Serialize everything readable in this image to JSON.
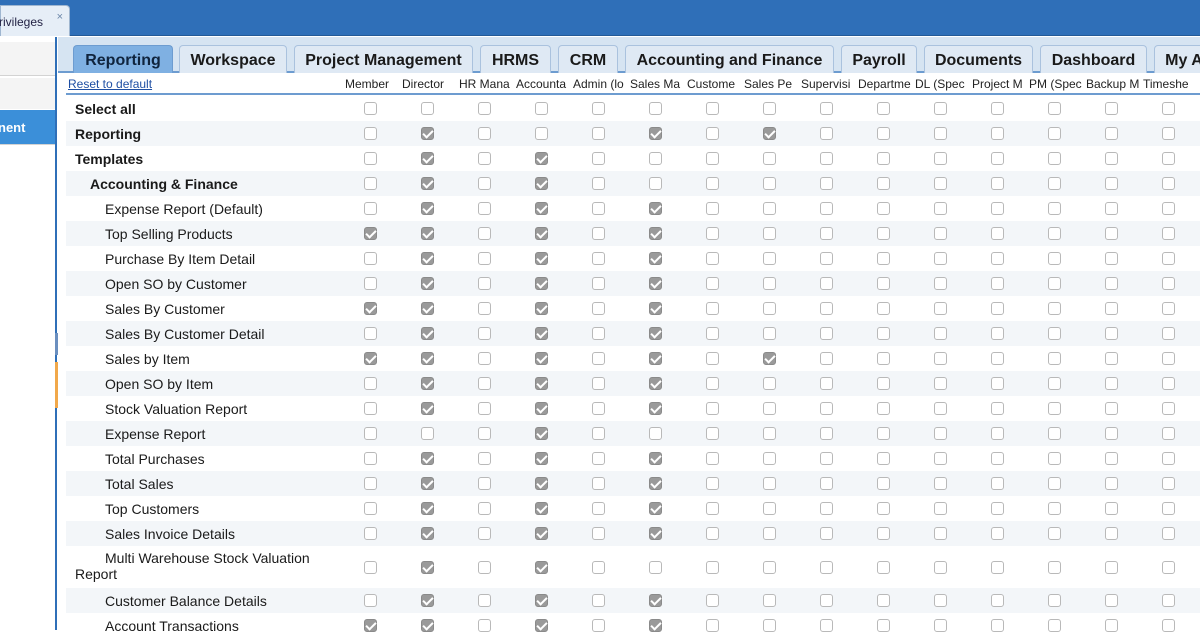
{
  "window": {
    "doc_tab_label": "rivileges",
    "doc_tab_close": "×"
  },
  "left_panel": {
    "active_label": "nent"
  },
  "tabs": [
    "Reporting",
    "Workspace",
    "Project Management",
    "HRMS",
    "CRM",
    "Accounting and Finance",
    "Payroll",
    "Documents",
    "Dashboard",
    "My A"
  ],
  "active_tab": "Reporting",
  "reset_link": "Reset to default",
  "columns": [
    "Member",
    "Director",
    "HR Mana",
    "Accounta",
    "Admin (lo",
    "Sales Ma",
    "Custome",
    "Sales Pe",
    "Supervisi",
    "Departme",
    "DL (Spec",
    "Project M",
    "PM (Spec",
    "Backup M",
    "Timeshe"
  ],
  "rows": [
    {
      "label": "Select all",
      "level": 1,
      "bold": true,
      "checks": [
        0,
        0,
        0,
        0,
        0,
        0,
        0,
        0,
        0,
        0,
        0,
        0,
        0,
        0,
        0
      ]
    },
    {
      "label": "Reporting",
      "level": 1,
      "bold": true,
      "checks": [
        0,
        1,
        0,
        0,
        0,
        1,
        0,
        1,
        0,
        0,
        0,
        0,
        0,
        0,
        0
      ]
    },
    {
      "label": "Templates",
      "level": 1,
      "bold": true,
      "checks": [
        0,
        1,
        0,
        1,
        0,
        0,
        0,
        0,
        0,
        0,
        0,
        0,
        0,
        0,
        0
      ]
    },
    {
      "label": "Accounting & Finance",
      "level": 2,
      "bold": true,
      "checks": [
        0,
        1,
        0,
        1,
        0,
        0,
        0,
        0,
        0,
        0,
        0,
        0,
        0,
        0,
        0
      ]
    },
    {
      "label": "Expense Report (Default)",
      "level": 3,
      "bold": false,
      "checks": [
        0,
        1,
        0,
        1,
        0,
        1,
        0,
        0,
        0,
        0,
        0,
        0,
        0,
        0,
        0
      ]
    },
    {
      "label": "Top Selling Products",
      "level": 3,
      "bold": false,
      "checks": [
        1,
        1,
        0,
        1,
        0,
        1,
        0,
        0,
        0,
        0,
        0,
        0,
        0,
        0,
        0
      ]
    },
    {
      "label": "Purchase By Item Detail",
      "level": 3,
      "bold": false,
      "checks": [
        0,
        1,
        0,
        1,
        0,
        1,
        0,
        0,
        0,
        0,
        0,
        0,
        0,
        0,
        0
      ]
    },
    {
      "label": "Open SO by Customer",
      "level": 3,
      "bold": false,
      "checks": [
        0,
        1,
        0,
        1,
        0,
        1,
        0,
        0,
        0,
        0,
        0,
        0,
        0,
        0,
        0
      ]
    },
    {
      "label": "Sales By Customer",
      "level": 3,
      "bold": false,
      "checks": [
        1,
        1,
        0,
        1,
        0,
        1,
        0,
        0,
        0,
        0,
        0,
        0,
        0,
        0,
        0
      ]
    },
    {
      "label": "Sales By Customer Detail",
      "level": 3,
      "bold": false,
      "checks": [
        0,
        1,
        0,
        1,
        0,
        1,
        0,
        0,
        0,
        0,
        0,
        0,
        0,
        0,
        0
      ]
    },
    {
      "label": "Sales by Item",
      "level": 3,
      "bold": false,
      "checks": [
        1,
        1,
        0,
        1,
        0,
        1,
        0,
        1,
        0,
        0,
        0,
        0,
        0,
        0,
        0
      ]
    },
    {
      "label": "Open SO by Item",
      "level": 3,
      "bold": false,
      "checks": [
        0,
        1,
        0,
        1,
        0,
        1,
        0,
        0,
        0,
        0,
        0,
        0,
        0,
        0,
        0
      ]
    },
    {
      "label": "Stock Valuation Report",
      "level": 3,
      "bold": false,
      "checks": [
        0,
        1,
        0,
        1,
        0,
        1,
        0,
        0,
        0,
        0,
        0,
        0,
        0,
        0,
        0
      ]
    },
    {
      "label": "Expense Report",
      "level": 3,
      "bold": false,
      "checks": [
        0,
        0,
        0,
        1,
        0,
        0,
        0,
        0,
        0,
        0,
        0,
        0,
        0,
        0,
        0
      ]
    },
    {
      "label": "Total Purchases",
      "level": 3,
      "bold": false,
      "checks": [
        0,
        1,
        0,
        1,
        0,
        1,
        0,
        0,
        0,
        0,
        0,
        0,
        0,
        0,
        0
      ]
    },
    {
      "label": "Total Sales",
      "level": 3,
      "bold": false,
      "checks": [
        0,
        1,
        0,
        1,
        0,
        1,
        0,
        0,
        0,
        0,
        0,
        0,
        0,
        0,
        0
      ]
    },
    {
      "label": "Top Customers",
      "level": 3,
      "bold": false,
      "checks": [
        0,
        1,
        0,
        1,
        0,
        1,
        0,
        0,
        0,
        0,
        0,
        0,
        0,
        0,
        0
      ]
    },
    {
      "label": "Sales Invoice Details",
      "level": 3,
      "bold": false,
      "checks": [
        0,
        1,
        0,
        1,
        0,
        1,
        0,
        0,
        0,
        0,
        0,
        0,
        0,
        0,
        0
      ]
    },
    {
      "label": "Multi Warehouse Stock Valuation Report",
      "level": 3,
      "bold": false,
      "wrap": true,
      "checks": [
        0,
        1,
        0,
        1,
        0,
        0,
        0,
        0,
        0,
        0,
        0,
        0,
        0,
        0,
        0
      ]
    },
    {
      "label": "Customer Balance Details",
      "level": 3,
      "bold": false,
      "checks": [
        0,
        1,
        0,
        1,
        0,
        1,
        0,
        0,
        0,
        0,
        0,
        0,
        0,
        0,
        0
      ]
    },
    {
      "label": "Account Transactions",
      "level": 3,
      "bold": false,
      "checks": [
        1,
        1,
        0,
        1,
        0,
        1,
        0,
        0,
        0,
        0,
        0,
        0,
        0,
        0,
        0
      ]
    }
  ]
}
